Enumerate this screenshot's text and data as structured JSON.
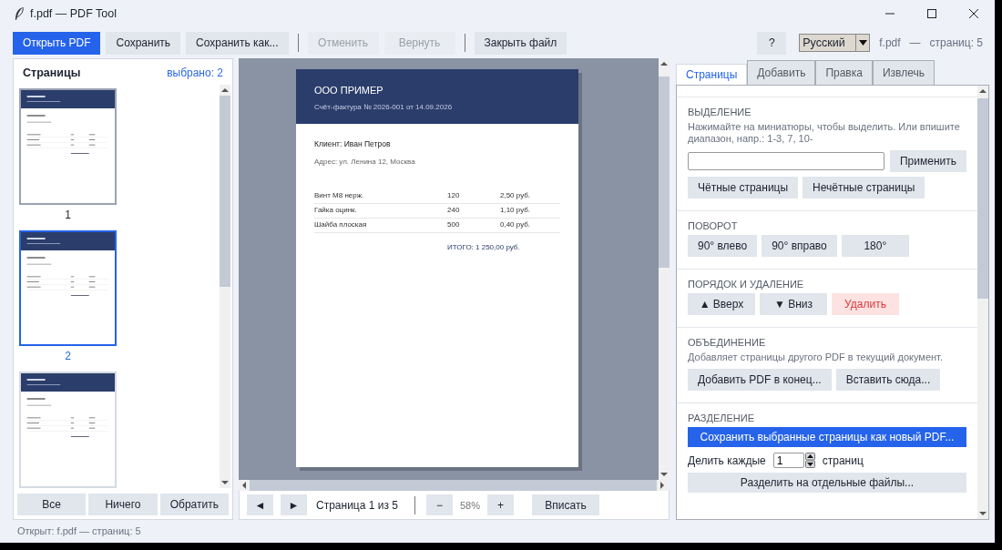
{
  "window": {
    "title": "f.pdf — PDF Tool"
  },
  "toolbar": {
    "groups": [
      {
        "buttons": [
          {
            "label": "Открыть PDF",
            "kind": "primary",
            "disabled": false
          },
          {
            "label": "Сохранить",
            "kind": "normal",
            "disabled": false
          },
          {
            "label": "Сохранить как...",
            "kind": "normal",
            "disabled": false
          }
        ]
      },
      {
        "buttons": [
          {
            "label": "Отменить",
            "kind": "normal",
            "disabled": true
          },
          {
            "label": "Вернуть",
            "kind": "normal",
            "disabled": true
          }
        ]
      },
      {
        "buttons": [
          {
            "label": "Закрыть файл",
            "kind": "normal",
            "disabled": false
          }
        ]
      }
    ],
    "help": "?",
    "language": "Русский",
    "file_name": "f.pdf",
    "file_sep": "—",
    "page_count": "страниц: 5"
  },
  "left_panel": {
    "title": "Страницы",
    "selected_count": "выбрано: 2",
    "thumbnails": [
      {
        "label": "1",
        "selected": false,
        "current": true
      },
      {
        "label": "2",
        "selected": true,
        "current": false
      },
      {
        "selected": false,
        "current": false
      }
    ],
    "buttons": [
      "Все",
      "Ничего",
      "Обратить"
    ]
  },
  "viewer": {
    "page": {
      "company": "ООО ПРИМЕР",
      "invoice": "Счёт-фактура № 2026-001 от 14.09.2026",
      "client": "Клиент: Иван Петров",
      "address": "Адрес: ул. Ленина 12, Москва",
      "rows": [
        [
          "Винт М8 нерж.",
          "120",
          "2,50 руб."
        ],
        [
          "Гайка оцинк.",
          "240",
          "1,10 руб."
        ],
        [
          "Шайба плоская",
          "500",
          "0,40 руб."
        ]
      ],
      "total": "ИТОГО: 1 250,00 руб."
    },
    "nav": {
      "prev": "◄",
      "next": "►",
      "page_label": "Страница 1 из 5",
      "zoom_out": "−",
      "zoom": "58%",
      "zoom_in": "+",
      "fit": "Вписать"
    }
  },
  "right_panel": {
    "tabs": [
      {
        "label": "Страницы",
        "selected": true
      },
      {
        "label": "Добавить",
        "selected": false
      },
      {
        "label": "Правка",
        "selected": false
      },
      {
        "label": "Извлечь",
        "selected": false
      }
    ],
    "sections": [
      {
        "title": "ВЫДЕЛЕНИЕ",
        "items": [
          {
            "kind": "text",
            "text": "Нажимайте на миниатюры, чтобы выделить. Или впишите диапазон, напр.: 1-3, 7, 10-"
          },
          {
            "kind": "input_row",
            "button": "Применить"
          },
          {
            "kind": "buttons",
            "buttons": [
              {
                "label": "Чётные страницы",
                "kind": "normal"
              },
              {
                "label": "Нечётные страницы",
                "kind": "normal"
              }
            ]
          }
        ]
      },
      {
        "title": "ПОВОРОТ",
        "items": [
          {
            "kind": "buttons",
            "buttons": [
              {
                "label": "90° влево",
                "kind": "normal"
              },
              {
                "label": "90° вправо",
                "kind": "normal"
              },
              {
                "label": "180°",
                "kind": "normal"
              }
            ]
          }
        ]
      },
      {
        "title": "ПОРЯДОК И УДАЛЕНИЕ",
        "items": [
          {
            "kind": "buttons",
            "buttons": [
              {
                "label": "▲ Вверх",
                "kind": "normal"
              },
              {
                "label": "▼ Вниз",
                "kind": "normal"
              },
              {
                "label": "Удалить",
                "kind": "danger"
              }
            ]
          }
        ]
      },
      {
        "title": "ОБЪЕДИНЕНИЕ",
        "items": [
          {
            "kind": "text",
            "text": "Добавляет страницы другого PDF в текущий документ."
          },
          {
            "kind": "buttons",
            "buttons": [
              {
                "label": "Добавить PDF в конец...",
                "kind": "normal"
              },
              {
                "label": "Вставить сюда...",
                "kind": "normal"
              }
            ]
          }
        ]
      },
      {
        "title": "РАЗДЕЛЕНИЕ",
        "items": [
          {
            "kind": "wide_button",
            "button": {
              "label": "Сохранить выбранные страницы как новый PDF...",
              "kind": "primary"
            }
          },
          {
            "kind": "spin_row",
            "label": "Делить каждые",
            "value": "1",
            "unit": "страниц"
          },
          {
            "kind": "wide_button",
            "button": {
              "label": "Разделить на отдельные файлы...",
              "kind": "normal"
            }
          }
        ]
      }
    ]
  },
  "status_bar": "Открыт: f.pdf — страниц: 5"
}
